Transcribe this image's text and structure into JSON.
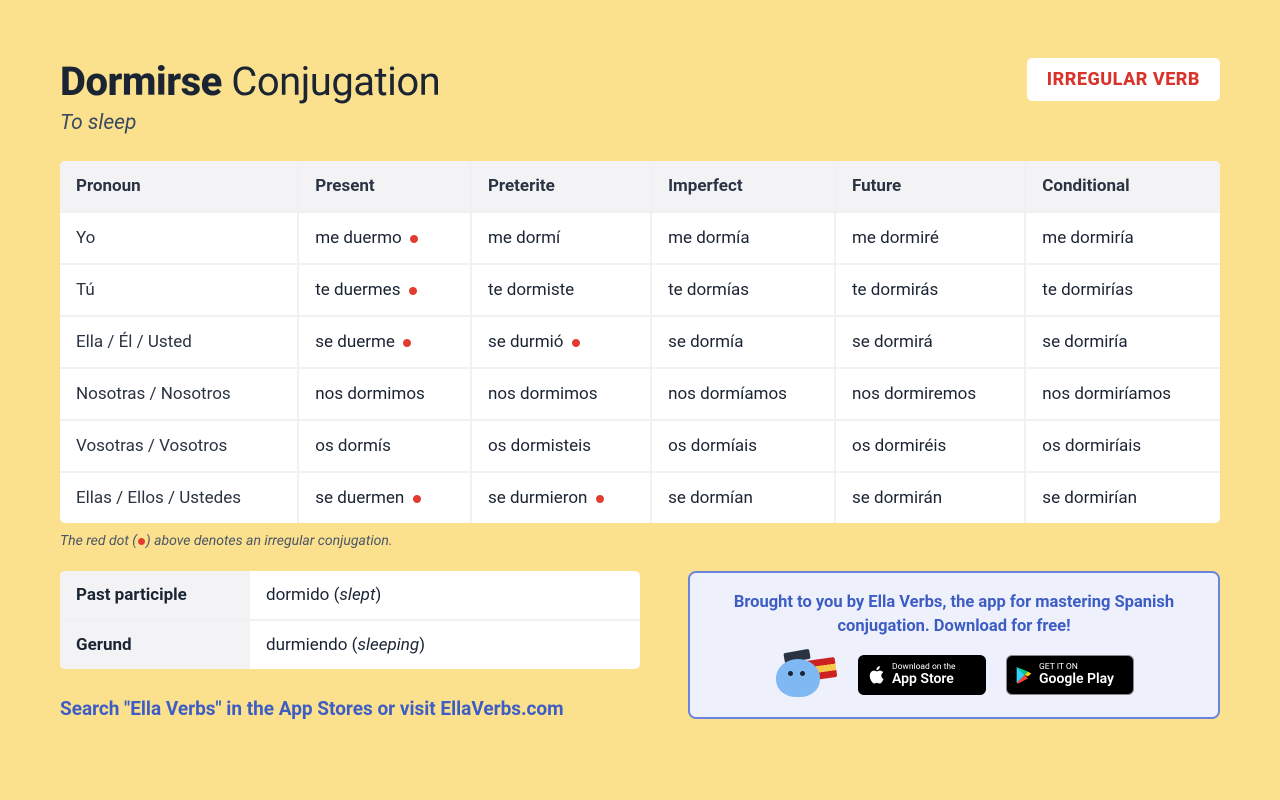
{
  "header": {
    "verb": "Dormirse",
    "title_suffix": "Conjugation",
    "translation": "To sleep",
    "badge": "IRREGULAR VERB"
  },
  "table": {
    "columns": [
      "Pronoun",
      "Present",
      "Preterite",
      "Imperfect",
      "Future",
      "Conditional"
    ],
    "rows": [
      {
        "pronoun": "Yo",
        "present": {
          "t": "me duermo",
          "irr": true
        },
        "preterite": {
          "t": "me dormí",
          "irr": false
        },
        "imperfect": {
          "t": "me dormía",
          "irr": false
        },
        "future": {
          "t": "me dormiré",
          "irr": false
        },
        "conditional": {
          "t": "me dormiría",
          "irr": false
        }
      },
      {
        "pronoun": "Tú",
        "present": {
          "t": "te duermes",
          "irr": true
        },
        "preterite": {
          "t": "te dormiste",
          "irr": false
        },
        "imperfect": {
          "t": "te dormías",
          "irr": false
        },
        "future": {
          "t": "te dormirás",
          "irr": false
        },
        "conditional": {
          "t": "te dormirías",
          "irr": false
        }
      },
      {
        "pronoun": "Ella / Él / Usted",
        "present": {
          "t": "se duerme",
          "irr": true
        },
        "preterite": {
          "t": "se durmió",
          "irr": true
        },
        "imperfect": {
          "t": "se dormía",
          "irr": false
        },
        "future": {
          "t": "se dormirá",
          "irr": false
        },
        "conditional": {
          "t": "se dormiría",
          "irr": false
        }
      },
      {
        "pronoun": "Nosotras / Nosotros",
        "present": {
          "t": "nos dormimos",
          "irr": false
        },
        "preterite": {
          "t": "nos dormimos",
          "irr": false
        },
        "imperfect": {
          "t": "nos dormíamos",
          "irr": false
        },
        "future": {
          "t": "nos dormiremos",
          "irr": false
        },
        "conditional": {
          "t": "nos dormiríamos",
          "irr": false
        }
      },
      {
        "pronoun": "Vosotras / Vosotros",
        "present": {
          "t": "os dormís",
          "irr": false
        },
        "preterite": {
          "t": "os dormisteis",
          "irr": false
        },
        "imperfect": {
          "t": "os dormíais",
          "irr": false
        },
        "future": {
          "t": "os dormiréis",
          "irr": false
        },
        "conditional": {
          "t": "os dormiríais",
          "irr": false
        }
      },
      {
        "pronoun": "Ellas / Ellos / Ustedes",
        "present": {
          "t": "se duermen",
          "irr": true
        },
        "preterite": {
          "t": "se durmieron",
          "irr": true
        },
        "imperfect": {
          "t": "se dormían",
          "irr": false
        },
        "future": {
          "t": "se dormirán",
          "irr": false
        },
        "conditional": {
          "t": "se dormirían",
          "irr": false
        }
      }
    ]
  },
  "legend": {
    "prefix": "The red dot (",
    "suffix": ") above denotes an irregular conjugation."
  },
  "forms": {
    "past_participle": {
      "label": "Past participle",
      "es": "dormido",
      "en": "slept"
    },
    "gerund": {
      "label": "Gerund",
      "es": "durmiendo",
      "en": "sleeping"
    }
  },
  "search_line": "Search \"Ella Verbs\" in the App Stores or visit EllaVerbs.com",
  "promo": {
    "text": "Brought to you by Ella Verbs, the app for mastering Spanish conjugation. Download for free!",
    "appstore": {
      "small": "Download on the",
      "large": "App Store"
    },
    "googleplay": {
      "small": "GET IT ON",
      "large": "Google Play"
    }
  }
}
